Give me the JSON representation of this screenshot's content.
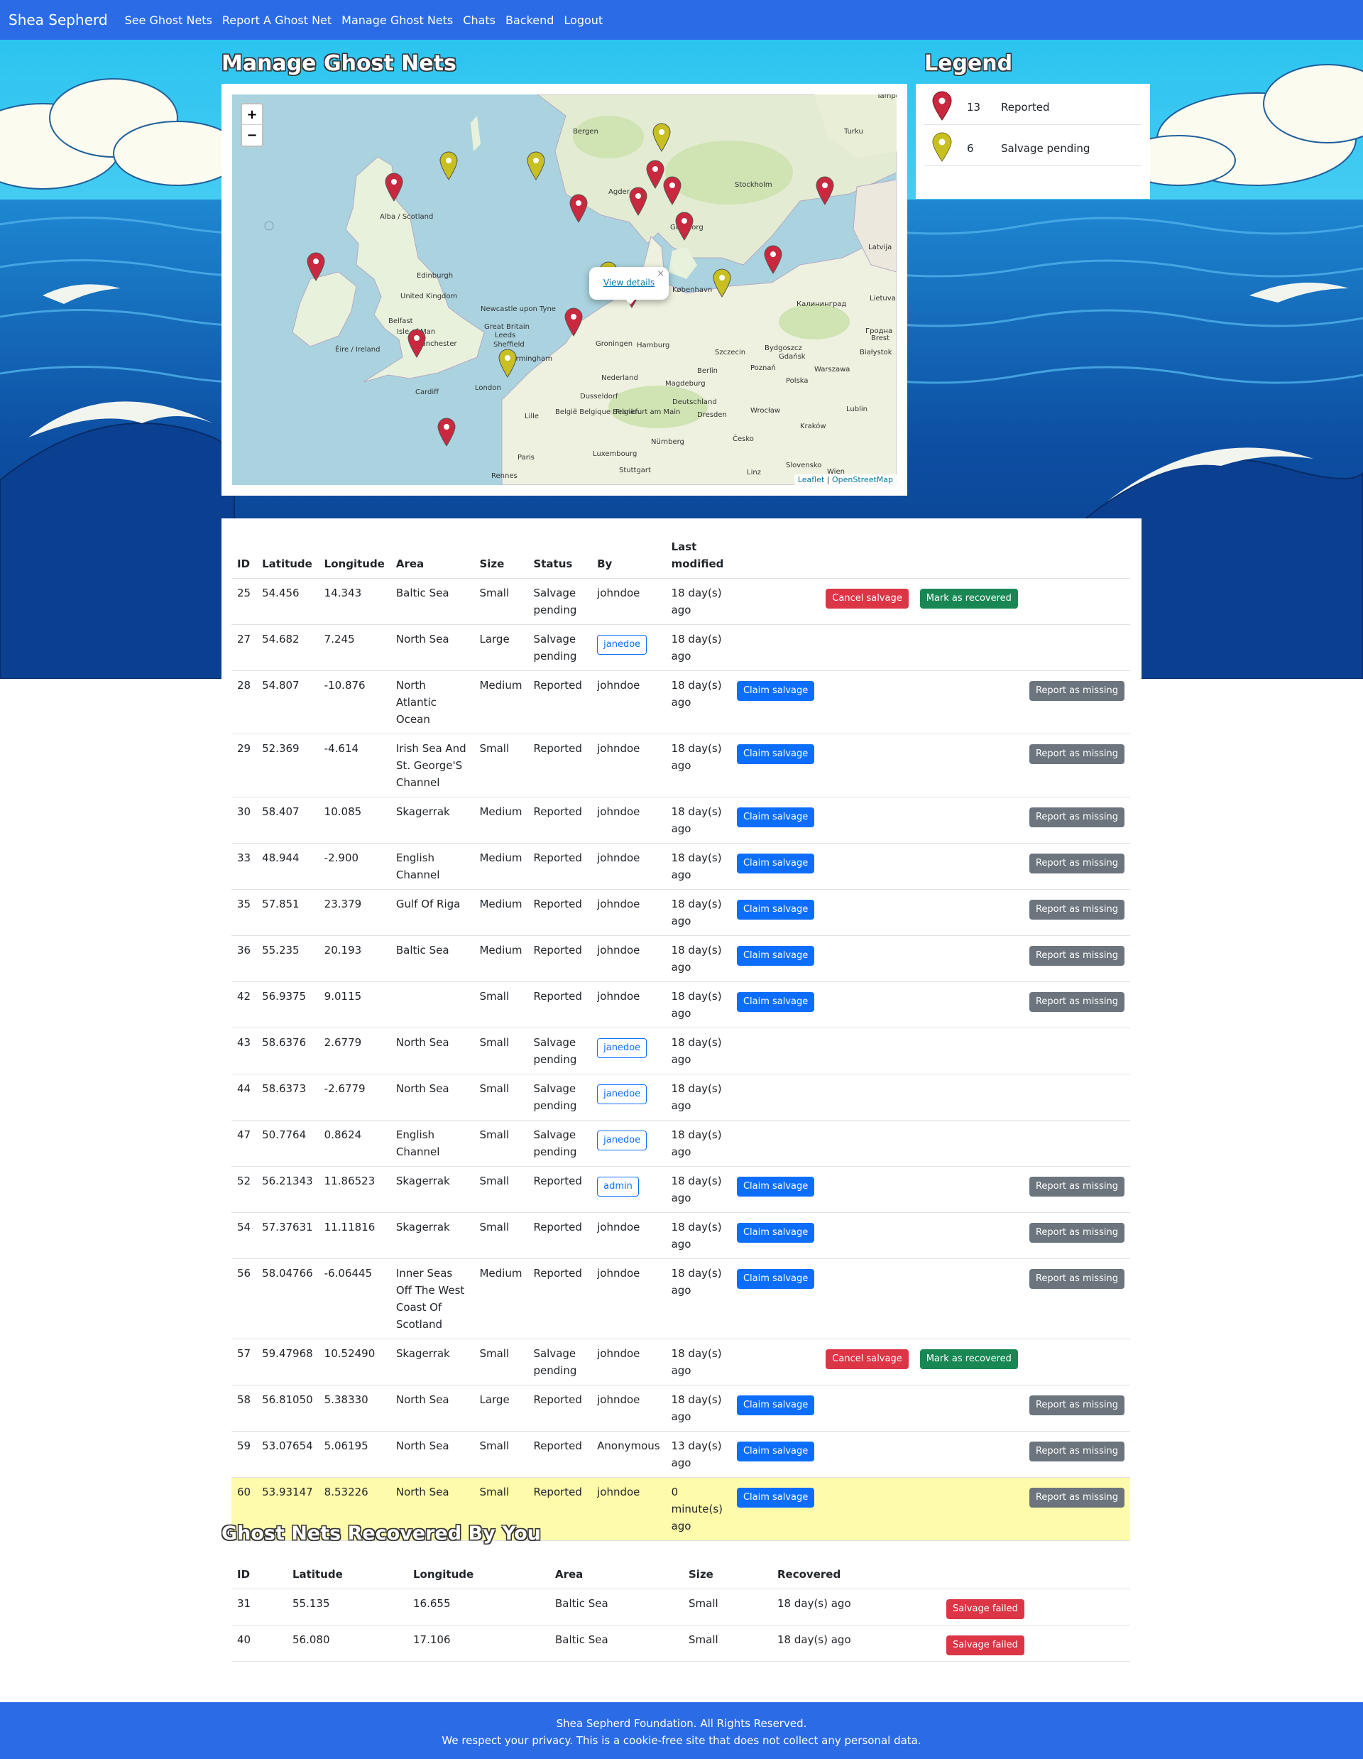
{
  "nav": {
    "brand": "Shea Sepherd",
    "links": [
      "See Ghost Nets",
      "Report A Ghost Net",
      "Manage Ghost Nets",
      "Chats",
      "Backend",
      "Logout"
    ]
  },
  "manage_title": "Manage Ghost Nets",
  "legend_title": "Legend",
  "legend": [
    {
      "count": "13",
      "label": "Reported",
      "color": "#c9283e"
    },
    {
      "count": "6",
      "label": "Salvage pending",
      "color": "#c8c022"
    }
  ],
  "map": {
    "zoom_in": "+",
    "zoom_out": "−",
    "popup_link": "View details",
    "popup_close": "×",
    "attribution_leaflet": "Leaflet",
    "attribution_sep": " | ",
    "attribution_osm": "OpenStreetMap",
    "place_labels": [
      {
        "text": "Bergen"
      },
      {
        "text": "Turku"
      },
      {
        "text": "Stockholm"
      },
      {
        "text": "Tampere"
      },
      {
        "text": "Edinburgh"
      },
      {
        "text": "United Kingdom"
      },
      {
        "text": "Belfast"
      },
      {
        "text": "Isle of Man"
      },
      {
        "text": "Newcastle upon Tyne"
      },
      {
        "text": "Great Britain"
      },
      {
        "text": "Leeds"
      },
      {
        "text": "Manchester"
      },
      {
        "text": "Sheffield"
      },
      {
        "text": "Birmingham"
      },
      {
        "text": "Éire / Ireland"
      },
      {
        "text": "Cardiff"
      },
      {
        "text": "London"
      },
      {
        "text": "Lille"
      },
      {
        "text": "Paris"
      },
      {
        "text": "Rennes"
      },
      {
        "text": "Groningen"
      },
      {
        "text": "Hamburg"
      },
      {
        "text": "Nederland"
      },
      {
        "text": "Berlin"
      },
      {
        "text": "Szczecin"
      },
      {
        "text": "Poznań"
      },
      {
        "text": "Warszawa"
      },
      {
        "text": "Polska"
      },
      {
        "text": "Deutschland"
      },
      {
        "text": "Magdeburg"
      },
      {
        "text": "Dresden"
      },
      {
        "text": "Wrocław"
      },
      {
        "text": "Kraków"
      },
      {
        "text": "Česko"
      },
      {
        "text": "Frankfurt am Main"
      },
      {
        "text": "Nürnberg"
      },
      {
        "text": "Stuttgart"
      },
      {
        "text": "Luxembourg"
      },
      {
        "text": "België Belgique Belgien"
      },
      {
        "text": "Dusseldorf"
      },
      {
        "text": "København"
      },
      {
        "text": "Göteborg"
      },
      {
        "text": "Agder"
      },
      {
        "text": "Gdańsk"
      },
      {
        "text": "Калининград"
      },
      {
        "text": "Bydgoszcz"
      },
      {
        "text": "Białystok"
      },
      {
        "text": "Latvija"
      },
      {
        "text": "Lietuva"
      },
      {
        "text": "Lublin"
      },
      {
        "text": "Linz"
      },
      {
        "text": "Wien"
      },
      {
        "text": "Slovensko"
      },
      {
        "text": "Alba / Scotland"
      },
      {
        "text": "Brest"
      },
      {
        "text": "Гродна"
      }
    ],
    "markers": [
      {
        "status": "Reported"
      },
      {
        "status": "Salvage pending"
      },
      {
        "status": "Salvage pending"
      },
      {
        "status": "Salvage pending"
      },
      {
        "status": "Reported"
      },
      {
        "status": "Reported"
      },
      {
        "status": "Reported"
      },
      {
        "status": "Reported"
      },
      {
        "status": "Reported"
      },
      {
        "status": "Reported"
      },
      {
        "status": "Reported"
      },
      {
        "status": "Reported"
      },
      {
        "status": "Salvage pending"
      },
      {
        "status": "Reported"
      },
      {
        "status": "Reported"
      },
      {
        "status": "Reported"
      },
      {
        "status": "Salvage pending"
      },
      {
        "status": "Reported"
      },
      {
        "status": "Salvage pending"
      }
    ]
  },
  "main_table": {
    "headers": [
      "ID",
      "Latitude",
      "Longitude",
      "Area",
      "Size",
      "Status",
      "By",
      "Last modified"
    ],
    "rows": [
      {
        "id": "25",
        "lat": "54.456",
        "lon": "14.343",
        "area": "Baltic Sea",
        "size": "Small",
        "status": "Salvage pending",
        "by": "johndoe",
        "by_badge": false,
        "modified": "18 day(s) ago",
        "claim": "",
        "cancel": "Cancel salvage",
        "recover": "Mark as recovered",
        "missing": "",
        "highlight": false
      },
      {
        "id": "27",
        "lat": "54.682",
        "lon": "7.245",
        "area": "North Sea",
        "size": "Large",
        "status": "Salvage pending",
        "by": "janedoe",
        "by_badge": true,
        "modified": "18 day(s) ago",
        "claim": "",
        "cancel": "",
        "recover": "",
        "missing": "",
        "highlight": false
      },
      {
        "id": "28",
        "lat": "54.807",
        "lon": "-10.876",
        "area": "North Atlantic Ocean",
        "size": "Medium",
        "status": "Reported",
        "by": "johndoe",
        "by_badge": false,
        "modified": "18 day(s) ago",
        "claim": "Claim salvage",
        "cancel": "",
        "recover": "",
        "missing": "Report as missing",
        "highlight": false
      },
      {
        "id": "29",
        "lat": "52.369",
        "lon": "-4.614",
        "area": "Irish Sea And St. George'S Channel",
        "size": "Small",
        "status": "Reported",
        "by": "johndoe",
        "by_badge": false,
        "modified": "18 day(s) ago",
        "claim": "Claim salvage",
        "cancel": "",
        "recover": "",
        "missing": "Report as missing",
        "highlight": false
      },
      {
        "id": "30",
        "lat": "58.407",
        "lon": "10.085",
        "area": "Skagerrak",
        "size": "Medium",
        "status": "Reported",
        "by": "johndoe",
        "by_badge": false,
        "modified": "18 day(s) ago",
        "claim": "Claim salvage",
        "cancel": "",
        "recover": "",
        "missing": "Report as missing",
        "highlight": false
      },
      {
        "id": "33",
        "lat": "48.944",
        "lon": "-2.900",
        "area": "English Channel",
        "size": "Medium",
        "status": "Reported",
        "by": "johndoe",
        "by_badge": false,
        "modified": "18 day(s) ago",
        "claim": "Claim salvage",
        "cancel": "",
        "recover": "",
        "missing": "Report as missing",
        "highlight": false
      },
      {
        "id": "35",
        "lat": "57.851",
        "lon": "23.379",
        "area": "Gulf Of Riga",
        "size": "Medium",
        "status": "Reported",
        "by": "johndoe",
        "by_badge": false,
        "modified": "18 day(s) ago",
        "claim": "Claim salvage",
        "cancel": "",
        "recover": "",
        "missing": "Report as missing",
        "highlight": false
      },
      {
        "id": "36",
        "lat": "55.235",
        "lon": "20.193",
        "area": "Baltic Sea",
        "size": "Medium",
        "status": "Reported",
        "by": "johndoe",
        "by_badge": false,
        "modified": "18 day(s) ago",
        "claim": "Claim salvage",
        "cancel": "",
        "recover": "",
        "missing": "Report as missing",
        "highlight": false
      },
      {
        "id": "42",
        "lat": "56.9375",
        "lon": "9.0115",
        "area": "",
        "size": "Small",
        "status": "Reported",
        "by": "johndoe",
        "by_badge": false,
        "modified": "18 day(s) ago",
        "claim": "Claim salvage",
        "cancel": "",
        "recover": "",
        "missing": "Report as missing",
        "highlight": false
      },
      {
        "id": "43",
        "lat": "58.6376",
        "lon": "2.6779",
        "area": "North Sea",
        "size": "Small",
        "status": "Salvage pending",
        "by": "janedoe",
        "by_badge": true,
        "modified": "18 day(s) ago",
        "claim": "",
        "cancel": "",
        "recover": "",
        "missing": "",
        "highlight": false
      },
      {
        "id": "44",
        "lat": "58.6373",
        "lon": "-2.6779",
        "area": "North Sea",
        "size": "Small",
        "status": "Salvage pending",
        "by": "janedoe",
        "by_badge": true,
        "modified": "18 day(s) ago",
        "claim": "",
        "cancel": "",
        "recover": "",
        "missing": "",
        "highlight": false
      },
      {
        "id": "47",
        "lat": "50.7764",
        "lon": "0.8624",
        "area": "English Channel",
        "size": "Small",
        "status": "Salvage pending",
        "by": "janedoe",
        "by_badge": true,
        "modified": "18 day(s) ago",
        "claim": "",
        "cancel": "",
        "recover": "",
        "missing": "",
        "highlight": false
      },
      {
        "id": "52",
        "lat": "56.21343",
        "lon": "11.86523",
        "area": "Skagerrak",
        "size": "Small",
        "status": "Reported",
        "by": "admin",
        "by_badge": true,
        "modified": "18 day(s) ago",
        "claim": "Claim salvage",
        "cancel": "",
        "recover": "",
        "missing": "Report as missing",
        "highlight": false
      },
      {
        "id": "54",
        "lat": "57.37631",
        "lon": "11.11816",
        "area": "Skagerrak",
        "size": "Small",
        "status": "Reported",
        "by": "johndoe",
        "by_badge": false,
        "modified": "18 day(s) ago",
        "claim": "Claim salvage",
        "cancel": "",
        "recover": "",
        "missing": "Report as missing",
        "highlight": false
      },
      {
        "id": "56",
        "lat": "58.04766",
        "lon": "-6.06445",
        "area": "Inner Seas Off The West Coast Of Scotland",
        "size": "Medium",
        "status": "Reported",
        "by": "johndoe",
        "by_badge": false,
        "modified": "18 day(s) ago",
        "claim": "Claim salvage",
        "cancel": "",
        "recover": "",
        "missing": "Report as missing",
        "highlight": false
      },
      {
        "id": "57",
        "lat": "59.47968",
        "lon": "10.52490",
        "area": "Skagerrak",
        "size": "Small",
        "status": "Salvage pending",
        "by": "johndoe",
        "by_badge": false,
        "modified": "18 day(s) ago",
        "claim": "",
        "cancel": "Cancel salvage",
        "recover": "Mark as recovered",
        "missing": "",
        "highlight": false
      },
      {
        "id": "58",
        "lat": "56.81050",
        "lon": "5.38330",
        "area": "North Sea",
        "size": "Large",
        "status": "Reported",
        "by": "johndoe",
        "by_badge": false,
        "modified": "18 day(s) ago",
        "claim": "Claim salvage",
        "cancel": "",
        "recover": "",
        "missing": "Report as missing",
        "highlight": false
      },
      {
        "id": "59",
        "lat": "53.07654",
        "lon": "5.06195",
        "area": "North Sea",
        "size": "Small",
        "status": "Reported",
        "by": "Anonymous",
        "by_badge": false,
        "modified": "13 day(s) ago",
        "claim": "Claim salvage",
        "cancel": "",
        "recover": "",
        "missing": "Report as missing",
        "highlight": false
      },
      {
        "id": "60",
        "lat": "53.93147",
        "lon": "8.53226",
        "area": "North Sea",
        "size": "Small",
        "status": "Reported",
        "by": "johndoe",
        "by_badge": false,
        "modified": "0 minute(s) ago",
        "claim": "Claim salvage",
        "cancel": "",
        "recover": "",
        "missing": "Report as missing",
        "highlight": true
      }
    ]
  },
  "recovered_title": "Ghost Nets Recovered By You",
  "recovered_table": {
    "headers": [
      "ID",
      "Latitude",
      "Longitude",
      "Area",
      "Size",
      "Recovered"
    ],
    "rows": [
      {
        "id": "31",
        "lat": "55.135",
        "lon": "16.655",
        "area": "Baltic Sea",
        "size": "Small",
        "recovered": "18 day(s) ago",
        "action": "Salvage failed"
      },
      {
        "id": "40",
        "lat": "56.080",
        "lon": "17.106",
        "area": "Baltic Sea",
        "size": "Small",
        "recovered": "18 day(s) ago",
        "action": "Salvage failed"
      }
    ]
  },
  "footer": {
    "line1": "Shea Sepherd Foundation. All Rights Reserved.",
    "line2": "We respect your privacy. This is a cookie-free site that does not collect any personal data."
  }
}
